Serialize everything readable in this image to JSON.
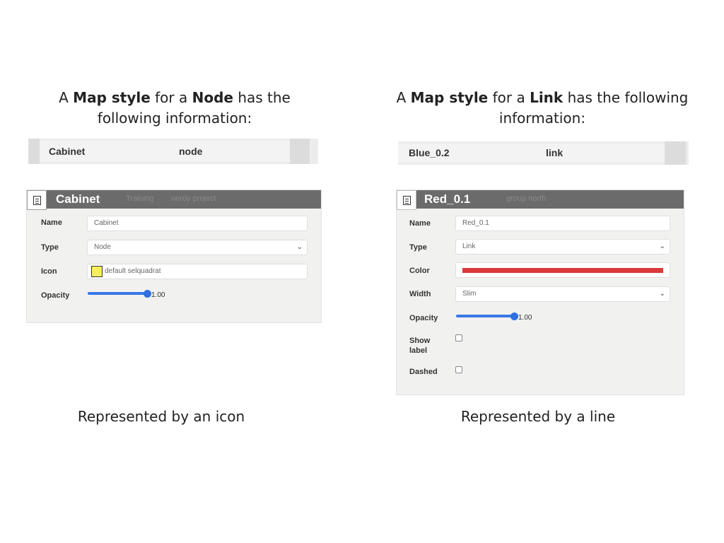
{
  "left": {
    "heading": {
      "prefix": "A ",
      "bold1": "Map style",
      "middle": " for a ",
      "bold2": "Node",
      "suffix": " has the",
      "line2": "following information:"
    },
    "row": {
      "name": "Cabinet",
      "type": "node"
    },
    "panel": {
      "title": "Cabinet",
      "ghost_text": [
        "Training",
        "nerdy project"
      ],
      "fields": {
        "name_label": "Name",
        "name_value": "Cabinet",
        "type_label": "Type",
        "type_value": "Node",
        "icon_label": "Icon",
        "icon_value": "default selquadrat",
        "icon_swatch_color": "#f5ef5a",
        "opacity_label": "Opacity",
        "opacity_value": "1.00"
      }
    },
    "caption": "Represented by an icon"
  },
  "right": {
    "heading": {
      "prefix": "A ",
      "bold1": "Map style",
      "middle": " for a ",
      "bold2": "Link",
      "suffix": " has the following",
      "line2": "information:"
    },
    "row": {
      "name": "Blue_0.2",
      "type": "link"
    },
    "panel": {
      "title": "Red_0.1",
      "ghost_text": [
        "group north"
      ],
      "fields": {
        "name_label": "Name",
        "name_value": "Red_0.1",
        "type_label": "Type",
        "type_value": "Link",
        "color_label": "Color",
        "color_value": "#d93a3a",
        "width_label": "Width",
        "width_value": "Slim",
        "opacity_label": "Opacity",
        "opacity_value": "1.00",
        "show_label_label_1": "Show",
        "show_label_label_2": "label",
        "show_label_checked": false,
        "dashed_label": "Dashed",
        "dashed_checked": false
      }
    },
    "caption": "Represented by a line"
  },
  "colors": {
    "titlebar": "#6b6b6b",
    "slider": "#3b78e7",
    "panel_bg": "#f1f1f0"
  }
}
